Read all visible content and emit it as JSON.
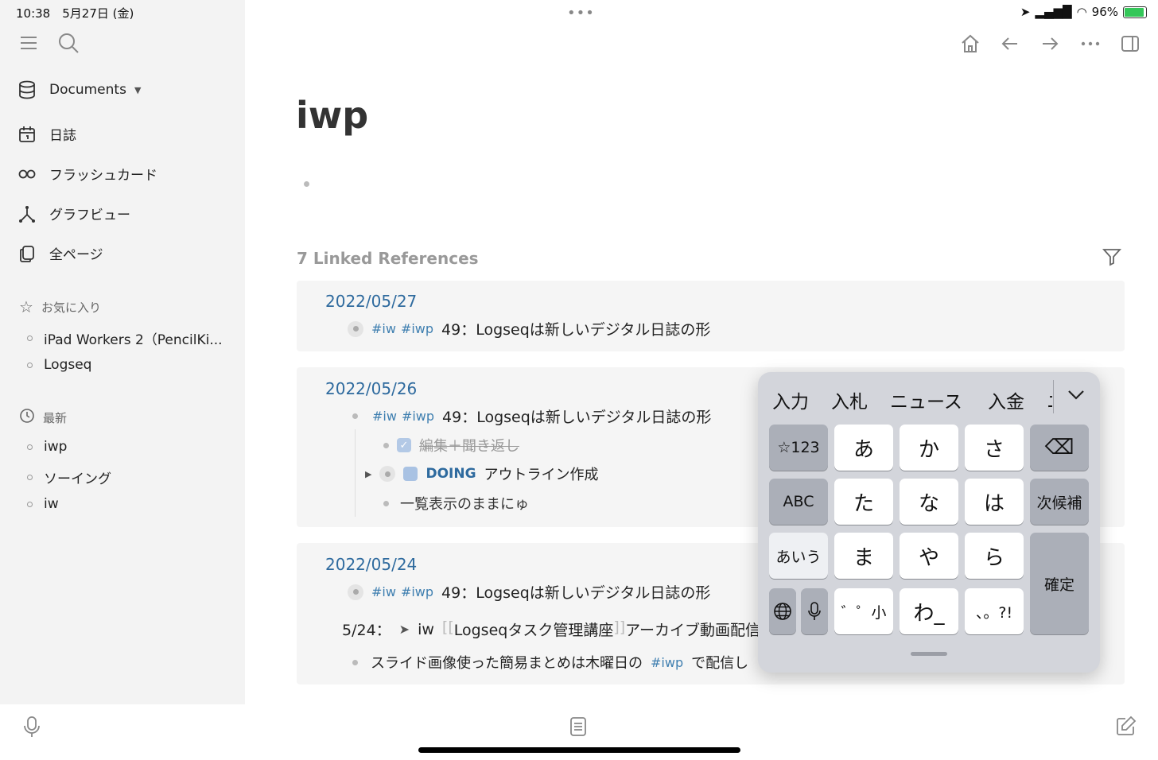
{
  "status": {
    "time": "10:38　5月27日 (金)",
    "battery": "96%"
  },
  "sidebar": {
    "graph_name": "Documents",
    "nav": [
      {
        "label": "日誌",
        "icon": "calendar-icon"
      },
      {
        "label": "フラッシュカード",
        "icon": "infinity-icon"
      },
      {
        "label": "グラフビュー",
        "icon": "graph-icon"
      },
      {
        "label": "全ページ",
        "icon": "pages-icon"
      }
    ],
    "favorites_title": "お気に入り",
    "favorites": [
      "iPad Workers 2（PencilKi...",
      "Logseq"
    ],
    "recent_title": "最新",
    "recent": [
      "iwp",
      "ソーイング",
      "iw"
    ]
  },
  "page": {
    "title": "iwp",
    "linked_refs_title": "7 Linked References"
  },
  "refs": [
    {
      "date": "2022/05/27",
      "line": {
        "tag1": "#iw",
        "tag2": "#iwp",
        "text": "49：Logseqは新しいデジタル日誌の形"
      }
    },
    {
      "date": "2022/05/26",
      "line": {
        "tag1": "#iw",
        "tag2": "#iwp",
        "text": "49：Logseqは新しいデジタル日誌の形"
      },
      "children": {
        "done_text": "編集＋聞き返し",
        "doing_marker": "DOING",
        "doing_text": "アウトライン作成",
        "last_text": "一覧表示のままにゅ"
      }
    },
    {
      "date": "2022/05/24",
      "line": {
        "tag1": "#iw",
        "tag2": "#iwp",
        "text": "49：Logseqは新しいデジタル日誌の形"
      },
      "extra1": {
        "prefix": "5/24：",
        "arrow": "➤",
        "iw": "iw",
        "bracket_open": "[[",
        "link": "Logseqタスク管理講座",
        "bracket_close": "]]",
        "rest": "アーカイブ動画配信"
      },
      "extra2": {
        "text": "スライド画像使った簡易まとめは木曜日の",
        "tag": "#iwp",
        "rest": "で配信し"
      }
    }
  ],
  "keyboard": {
    "candidates": [
      "入力",
      "入札",
      "ニュース",
      "入金",
      "ニ"
    ],
    "rows": [
      [
        "☆123",
        "あ",
        "か",
        "さ",
        "⌫"
      ],
      [
        "ABC",
        "た",
        "な",
        "は",
        "次候補"
      ],
      [
        "あいう",
        "ま",
        "や",
        "ら",
        "確定"
      ],
      [
        "🌐",
        "🎤",
        "゛゜小",
        "わ_",
        "、。?!"
      ]
    ]
  }
}
